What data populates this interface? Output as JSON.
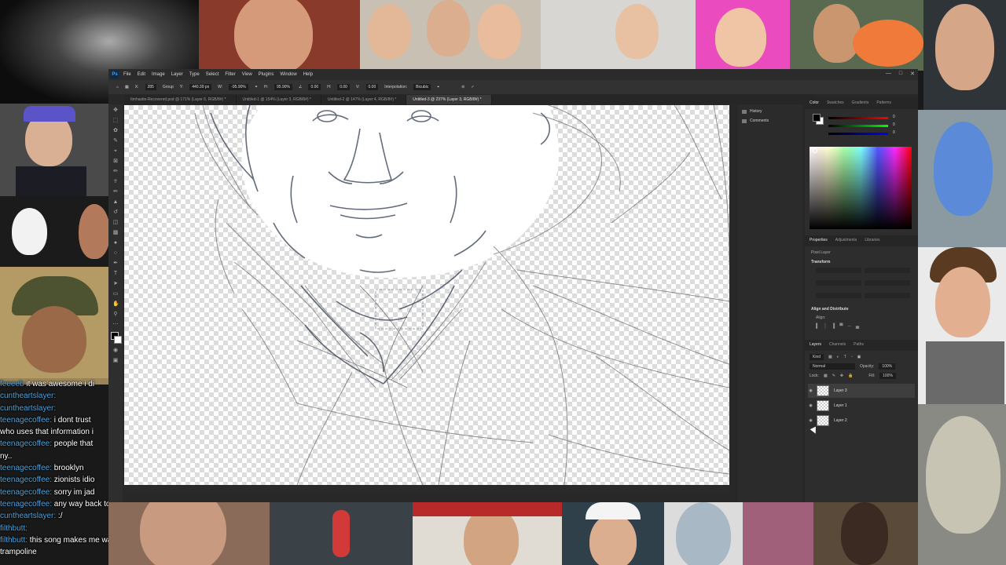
{
  "app": {
    "menu": [
      "File",
      "Edit",
      "Image",
      "Layer",
      "Type",
      "Select",
      "Filter",
      "View",
      "Plugins",
      "Window",
      "Help"
    ],
    "options_bar": {
      "x_label": "X:",
      "x": "285",
      "mode": "Group",
      "y_label": "Y:",
      "y": "440.39 px",
      "w_label": "W:",
      "w": "-95.90%",
      "h_label": "H:",
      "h": "95.90%",
      "angle": "0.00",
      "h_skew_label": "H:",
      "h_skew": "0.00",
      "v_skew_label": "V:",
      "v_skew": "0.00",
      "interpolation_label": "Interpolation:",
      "interpolation": "Bicubic"
    },
    "tabs": [
      {
        "label": "Itmhastle-Recovered.psd @ 171% (Layer 6, RGB/8#) *",
        "active": false
      },
      {
        "label": "Untitled-1 @ 154% (Layer 3, RGB/8#) *",
        "active": false
      },
      {
        "label": "Untitled-2 @ 147% (Layer 4, RGB/8#) *",
        "active": false
      },
      {
        "label": "Untitled-3 @ 237% (Layer 3, RGB/8#) *",
        "active": true
      }
    ],
    "mini_panel": [
      {
        "label": "History",
        "icon": "history-icon"
      },
      {
        "label": "Comments",
        "icon": "comments-icon"
      }
    ],
    "color_panel": {
      "tabs": [
        "Color",
        "Swatches",
        "Gradients",
        "Patterns"
      ],
      "r": "0",
      "g": "0",
      "b": "0",
      "fg_color": "#000000",
      "bg_color": "#ffffff"
    },
    "properties_panel": {
      "tabs": [
        "Properties",
        "Adjustments",
        "Libraries"
      ],
      "type": "Pixel Layer",
      "transform_title": "Transform",
      "align_title": "Align and Distribute",
      "align_label": "Align:"
    },
    "layers_panel": {
      "tabs": [
        "Layers",
        "Channels",
        "Paths"
      ],
      "filter": "Kind",
      "blend": "Normal",
      "opacity_label": "Opacity:",
      "opacity": "100%",
      "lock_label": "Lock:",
      "fill_label": "Fill:",
      "fill": "100%",
      "layers": [
        {
          "name": "Layer 3",
          "selected": true
        },
        {
          "name": "Layer 1",
          "selected": false
        },
        {
          "name": "Layer 2",
          "selected": false
        }
      ]
    }
  },
  "chat": [
    {
      "user": "feeeeb",
      "message": " it was awesome i di"
    },
    {
      "user": "cuntheartslayer:",
      "message": ""
    },
    {
      "user": "cuntheartslayer:",
      "message": ""
    },
    {
      "user": "teenagecoffee:",
      "message": " i dont trust"
    },
    {
      "user": "",
      "message": "who uses that information i"
    },
    {
      "user": "teenagecoffee:",
      "message": " people that"
    },
    {
      "user": "",
      "message": "ny.."
    },
    {
      "user": "teenagecoffee:",
      "message": " brooklyn"
    },
    {
      "user": "teenagecoffee:",
      "message": " zionists idio"
    },
    {
      "user": "teenagecoffee:",
      "message": " sorry im jad"
    },
    {
      "user": "teenagecoffee:",
      "message": " any way back to PICKLES!!!"
    },
    {
      "user": "cuntheartslayer:",
      "message": " :/"
    },
    {
      "user": "filthbutt:",
      "message": ""
    },
    {
      "user": "filthbutt:",
      "message": " this song makes me want to jump on a"
    },
    {
      "user": "",
      "message": "trampoline"
    }
  ],
  "colors": {
    "accent": "#31a8ff",
    "chat_user": "#4aa3df"
  }
}
